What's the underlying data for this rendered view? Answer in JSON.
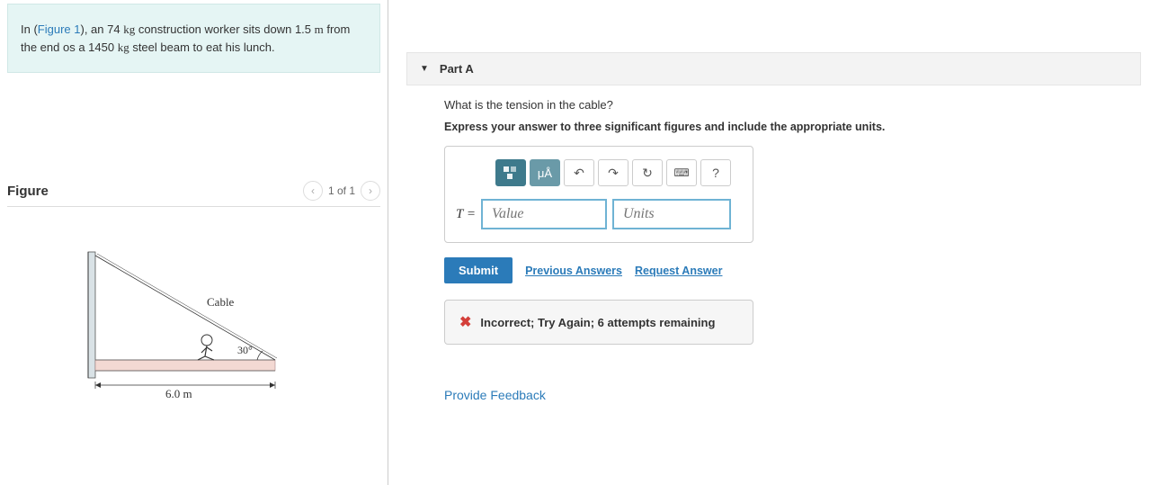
{
  "problem": {
    "prefix": "In (",
    "figlink": "Figure 1",
    "mid1": "), an 74 ",
    "unit1": "kg",
    "mid2": " construction worker sits down 1.5 ",
    "unit2": "m",
    "mid3": " from the end os a 1450 ",
    "unit3": "kg",
    "mid4": " steel beam to eat his lunch."
  },
  "figure": {
    "heading": "Figure",
    "pager": "1 of 1",
    "cable_label": "Cable",
    "angle_label": "30°",
    "length_label": "6.0 m"
  },
  "part": {
    "label": "Part A",
    "question": "What is the tension in the cable?",
    "instruction": "Express your answer to three significant figures and include the appropriate units."
  },
  "toolbar": {
    "templates": "▫",
    "symbols": "μÅ",
    "undo": "↶",
    "redo": "↷",
    "reset": "↻",
    "keyboard": "⌨",
    "help": "?"
  },
  "answer": {
    "var": "T",
    "eq": " = ",
    "value_placeholder": "Value",
    "units_placeholder": "Units"
  },
  "actions": {
    "submit": "Submit",
    "previous": "Previous Answers",
    "request": "Request Answer"
  },
  "feedback": {
    "icon": "✖",
    "message": "Incorrect; Try Again; 6 attempts remaining"
  },
  "footer": {
    "provide_feedback": "Provide Feedback"
  }
}
